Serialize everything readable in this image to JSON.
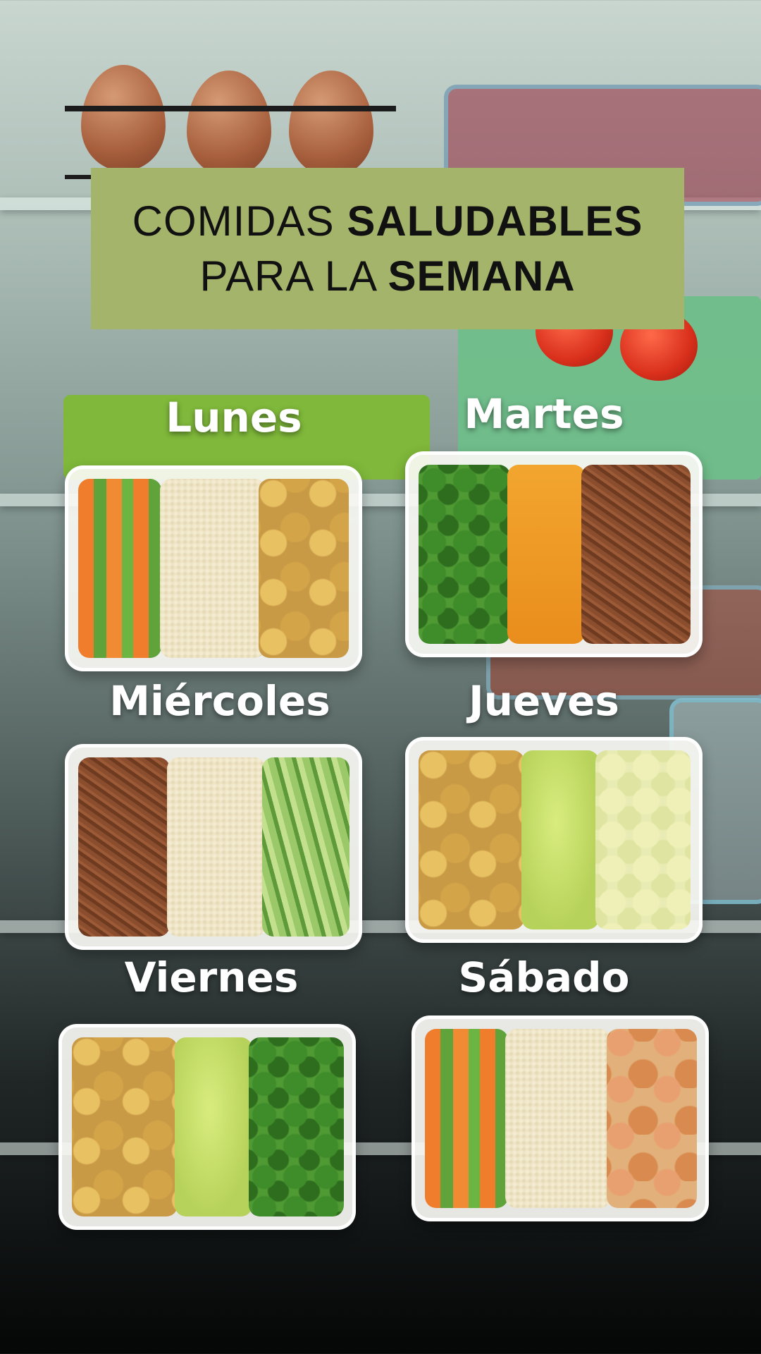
{
  "title": {
    "line1_regular": "COMIDAS ",
    "line1_bold": "SALUDABLES",
    "line2_regular": "PARA LA ",
    "line2_bold": "SEMANA"
  },
  "days": [
    {
      "label": "Lunes"
    },
    {
      "label": "Martes"
    },
    {
      "label": "Miércoles"
    },
    {
      "label": "Jueves"
    },
    {
      "label": "Viernes"
    },
    {
      "label": "Sábado"
    }
  ],
  "colors": {
    "title_box": "#a4b46b",
    "label_text": "#ffffff"
  }
}
